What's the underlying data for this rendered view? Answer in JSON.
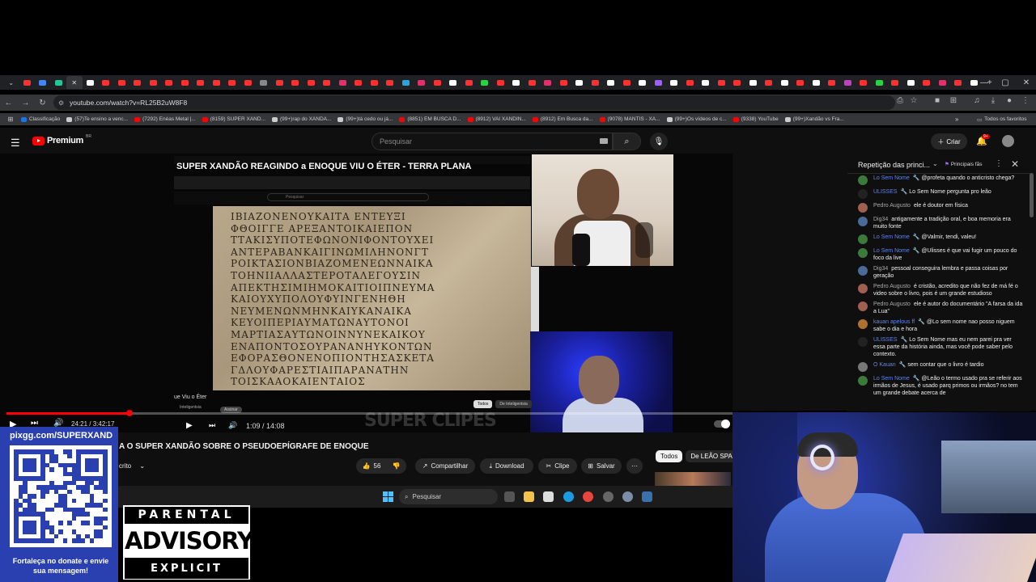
{
  "browser": {
    "url": "youtube.com/watch?v=RL25B2uW8F8",
    "all_bookmarks": "Todos os favoritos",
    "bookmarks": [
      {
        "label": "Classificação",
        "color": "#1a73e8"
      },
      {
        "label": "(57)Te ensino a venc...",
        "color": "#cccccc"
      },
      {
        "label": "(7292) Enéas Metal |...",
        "color": "#ff0000"
      },
      {
        "label": "(8159) SUPER XAND...",
        "color": "#ff0000"
      },
      {
        "label": "(99+)rap do XANDÃ...",
        "color": "#cccccc"
      },
      {
        "label": "(99+)tá cedo ou já...",
        "color": "#cccccc"
      },
      {
        "label": "(8851) EM BUSCA D...",
        "color": "#ff0000"
      },
      {
        "label": "(8912) VAI XANDIN...",
        "color": "#ff0000"
      },
      {
        "label": "(8912) Em Busca da...",
        "color": "#ff0000"
      },
      {
        "label": "(9078) MANTIS - XA...",
        "color": "#ff0000"
      },
      {
        "label": "(99+)Os vídeos de c...",
        "color": "#cccccc"
      },
      {
        "label": "(9338) YouTube",
        "color": "#ff0000"
      },
      {
        "label": "(99+)Xandão vs Fra...",
        "color": "#cccccc"
      }
    ]
  },
  "youtube": {
    "brand": "Premium",
    "region": "BR",
    "search_placeholder": "Pesquisar",
    "create_label": "Criar",
    "notifications": "9+"
  },
  "video": {
    "overlay_title": "SUPER XANDÃO REAGINDO a ENOQUE VIU O ÉTER - TERRA PLANA",
    "channel_watermark": "SUPER CLIPES",
    "time_current": "24:21",
    "time_total": "3:42:17",
    "progress": 0.17,
    "inner_time": "1:09 / 14:08",
    "inner_caption": "ue Viu o Éter",
    "inner_sub": "Inteligentsia",
    "inner_button": "Assinar",
    "inner_chip_all": "Todos",
    "inner_chip_other": "De Inteligentsia",
    "inner_search": "Pesquisar",
    "papyrus_lines": [
      "ΙΒΙΑΖΟΝΕΝΟΥΚΑΙΤΑ ΕΝΤΕΥΞΙ",
      "ΦΘΟΙΓΓΕ ΑΡΕΞΑΝΤΟΙΚΑΙΕΠΟΝ",
      "ΤΤΑΚΙΣΥΠΟΤΕΦΩΝΟΝΙΦΟΝΤΟΥΧΕΙ",
      "ΑΝΤΕΡΑΒΑΝΚΑΙΓΙΝΩΜΙΛΗΝΟΝΓΤ",
      "ΡΟΙΚΤΑΣΙΟΝΒΙΑΖΟΜΕΝΕΩΝΝΑΙΚΑ",
      "ΤΟΗΝΙΙΑΛΛΑΣΤΕΡΟΤΑΛΕΓΟΥΣΙΝ",
      "ΑΠΕΚΤΗΣΙΜΙΗΜΟΚΑΙΤΙΟΙΠΝΕΥΜΑ",
      "ΚΑΙΟΥΧΥΠΟΛΟΥΦΥΙΝΓΕΝΗΘΗ",
      "ΝΕΥΜΕΝΩΝΜΗΝΚΑΙΥΚΑΝΑΙΚΑ",
      "ΚΕΥΟΙΠΕΡΙΑΥΜΑΤΩΝΑΥΤΟΝΟΙ",
      "ΜΑΡΤΙΑΣΑΥΤΩΝΟΙΝΝΥΝΕΚΑΙΚΟΥ",
      "ΕΝΑΠΟΝΤΟΣΟΥΡΑΝΑΝΗΥΚΟΝΤΩΝ",
      "ΕΦΟΡΑΣΘΟΝΕΝΟΠΙΟΝΤΗΣΑΣΚΕΤΑ",
      "ΓΔΛΟΥΦΑΡΕΣΤΙΑΙΠΑΡΑΝΑΤΗΝ",
      "ΤΟΙΣΚΑΑΟΚΑΙΕΝΤΑΙΟΣ"
    ],
    "title": "A O SUPER XANDÃO SOBRE O PSEUDOEPÍGRAFE DE ENOQUE",
    "subscribe_label": "crito",
    "likes": "56",
    "share": "Compartilhar",
    "download": "Download",
    "clip": "Clipe",
    "save": "Salvar",
    "chips": [
      "Todos",
      "De LEÃO SPAR"
    ]
  },
  "taskbar": {
    "search": "Pesquisar"
  },
  "chat": {
    "title": "Repetição das princi...",
    "filter": "Principais fãs",
    "messages": [
      {
        "author": "Lo Sem Nome",
        "mod": true,
        "text": "@profeta quando o anticristo chega?",
        "color": "#3b7a3b"
      },
      {
        "author": "ULISSES",
        "mod": true,
        "text": "Lo Sem Nome pergunta pro leão",
        "color": "#222222"
      },
      {
        "author": "Pedro Augusto",
        "mod": false,
        "text": "ele é doutor em física",
        "color": "#a06050"
      },
      {
        "author": "Dig34",
        "mod": false,
        "text": "antigamente a tradição oral, e boa memoria era muito fonte",
        "color": "#4a6a9a"
      },
      {
        "author": "Lo Sem Nome",
        "mod": true,
        "text": "@Valmir, tendi, valeu!",
        "color": "#3b7a3b"
      },
      {
        "author": "Lo Sem Nome",
        "mod": true,
        "text": "@Ulisses é que vai fugir um pouco do foco da live",
        "color": "#3b7a3b"
      },
      {
        "author": "Dig34",
        "mod": false,
        "text": "pessoal conseguira lembra e passa coisas por geração",
        "color": "#4a6a9a"
      },
      {
        "author": "Pedro Augusto",
        "mod": false,
        "text": "é cristão, acredito que não fez de má fé o video sobre o livro, pois é um grande estudioso",
        "color": "#a06050"
      },
      {
        "author": "Pedro Augusto",
        "mod": false,
        "text": "ele é autor do documentário \"A farsa da ida a Lua\"",
        "color": "#a06050"
      },
      {
        "author": "kauan apelous ff",
        "mod": true,
        "text": "@Lo sem nome nao posso niguem sabe o dia e hora",
        "color": "#b07030"
      },
      {
        "author": "ULISSES",
        "mod": true,
        "text": "Lo Sem Nome mas eu nem parei pra ver essa parte da história ainda, mas você pode saber pelo contexto.",
        "color": "#222222"
      },
      {
        "author": "O Kauan",
        "mod": true,
        "text": "sem contar que o livro é tardio",
        "color": "#777777"
      },
      {
        "author": "Lo Sem Nome",
        "mod": true,
        "text": "@Leão o termo usado pra se referir aos irmãos de Jesus, é usado parq primos ou irmãos? no tem um grande debate acerca de",
        "color": "#3b7a3b"
      }
    ]
  },
  "overlay": {
    "donate_url": "pixgg.com/SUPERXAND",
    "donate_msg": "Fortaleça no donate e envie sua mensagem!",
    "advisory_top": "PARENTAL",
    "advisory_mid": "ADVISORY",
    "advisory_bot": "EXPLICIT CONTENT"
  },
  "colors": {
    "youtube_red": "#ff0000",
    "donate_bg": "#2a3fb0",
    "mod_name": "#5e84f1"
  }
}
